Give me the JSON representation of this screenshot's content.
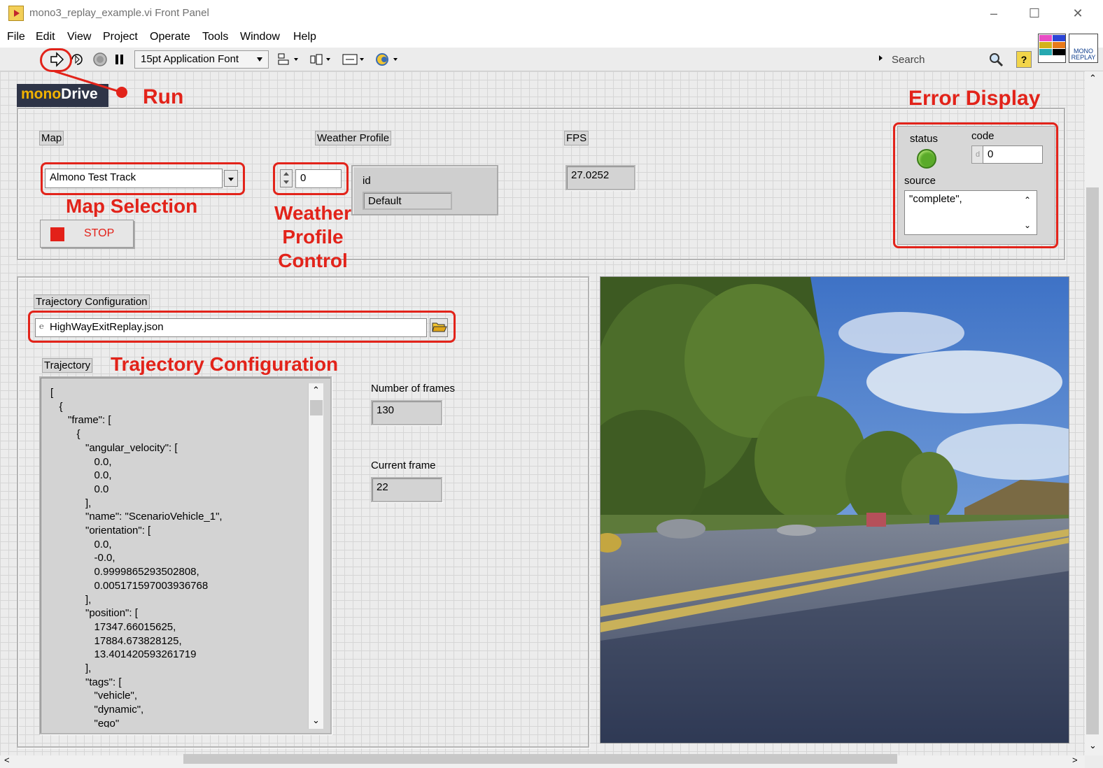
{
  "window": {
    "title": "mono3_replay_example.vi Front Panel"
  },
  "menu": [
    "File",
    "Edit",
    "View",
    "Project",
    "Operate",
    "Tools",
    "Window",
    "Help"
  ],
  "toolbar": {
    "font": "15pt Application Font",
    "search_placeholder": "Search"
  },
  "vi_icon": {
    "label_top": "MONO",
    "label_bottom": "REPLAY"
  },
  "logo": {
    "part1": "mono",
    "part2": "Drive"
  },
  "annotations": {
    "run": "Run",
    "map_selection": "Map Selection",
    "weather_line1": "Weather",
    "weather_line2": "Profile",
    "weather_line3": "Control",
    "error_display": "Error Display",
    "trajectory_config": "Trajectory Configuration"
  },
  "map": {
    "label": "Map",
    "value": "Almono Test Track"
  },
  "weather": {
    "label": "Weather Profile",
    "index": "0",
    "id_label": "id",
    "id_value": "Default"
  },
  "fps": {
    "label": "FPS",
    "value": "27.0252"
  },
  "stop": {
    "label": "STOP"
  },
  "error": {
    "status_label": "status",
    "code_label": "code",
    "code_radix": "d",
    "code_value": "0",
    "source_label": "source",
    "source_value": "\"complete\","
  },
  "trajectory_config": {
    "label": "Trajectory Configuration",
    "path": "HighWayExitReplay.json"
  },
  "trajectory": {
    "label": "Trajectory",
    "text": "[\n   {\n      \"frame\": [\n         {\n            \"angular_velocity\": [\n               0.0,\n               0.0,\n               0.0\n            ],\n            \"name\": \"ScenarioVehicle_1\",\n            \"orientation\": [\n               0.0,\n               -0.0,\n               0.9999865293502808,\n               0.005171597003936768\n            ],\n            \"position\": [\n               17347.66015625,\n               17884.673828125,\n               13.401420593261719\n            ],\n            \"tags\": [\n               \"vehicle\",\n               \"dynamic\",\n               \"ego\""
  },
  "frames": {
    "count_label": "Number of frames",
    "count": "130",
    "current_label": "Current frame",
    "current": "22"
  },
  "colors": {
    "annotation_red": "#e2231a",
    "status_green": "#5aaa2a",
    "stop_red": "#e32119"
  }
}
